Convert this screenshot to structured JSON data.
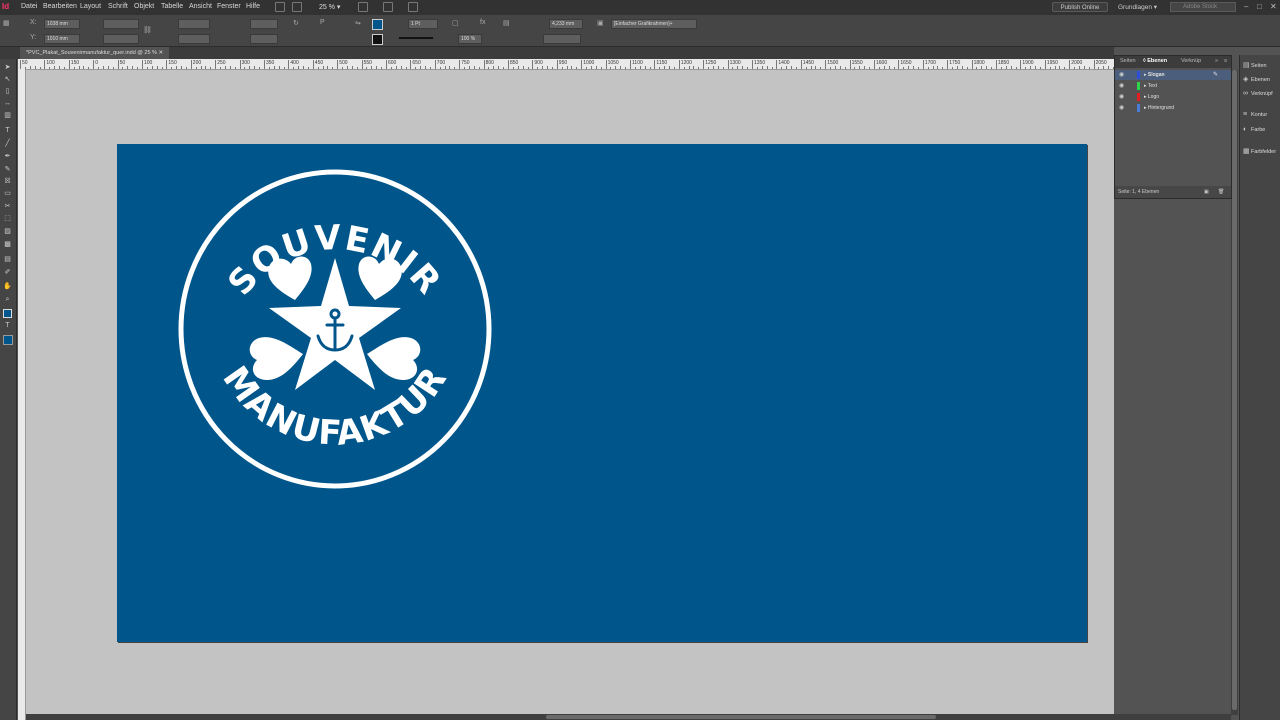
{
  "menu": {
    "app_icon": "Id",
    "items": [
      "Datei",
      "Bearbeiten",
      "Layout",
      "Schrift",
      "Objekt",
      "Tabelle",
      "Ansicht",
      "Fenster",
      "Hilfe"
    ],
    "zoom": "25 %",
    "publish": "Publish Online",
    "workspace": "Grundlagen",
    "search_placeholder": "Adobe Stock"
  },
  "control": {
    "x": "1038 mm",
    "y": "1010 mm",
    "stroke_weight": "1 Pt",
    "measure": "4,233 mm",
    "opacity": "100 %",
    "object_style": "[Einfacher Grafikrahmen]+"
  },
  "document_tab": "*PVC_Plakat_Souvenirmanufaktur_quer.indd @ 25 %",
  "ruler_labels": [
    "50",
    "100",
    "150",
    "0",
    "50",
    "100",
    "150",
    "200",
    "250",
    "300",
    "350",
    "400",
    "450",
    "500",
    "550",
    "600",
    "650",
    "700",
    "750",
    "800",
    "850",
    "900",
    "950",
    "1000",
    "1050",
    "1100",
    "1150",
    "1200",
    "1250",
    "1300",
    "1350",
    "1400",
    "1450",
    "1500",
    "1550",
    "1600",
    "1650",
    "1700",
    "1750",
    "1800",
    "1850",
    "1900",
    "1950",
    "2000",
    "2050"
  ],
  "page": {
    "background": "#00568b"
  },
  "logo": {
    "top_text": "SOUVENIR",
    "bottom_text": "MANUFAKTUR",
    "color": "#ffffff"
  },
  "layers_panel": {
    "tabs": [
      "Seiten",
      "Ebenen",
      "Verknüp"
    ],
    "layers": [
      {
        "name": "Slogan",
        "color": "#2f4fd8"
      },
      {
        "name": "Text",
        "color": "#2bd44c"
      },
      {
        "name": "Logo",
        "color": "#e02020"
      },
      {
        "name": "Hintergrund",
        "color": "#4a7bd6"
      }
    ],
    "footer": "Seite: 1, 4 Ebenen"
  },
  "dock": [
    "Seiten",
    "Ebenen",
    "Verknüpf",
    "Kontur",
    "Farbe",
    "Farbfelder"
  ]
}
